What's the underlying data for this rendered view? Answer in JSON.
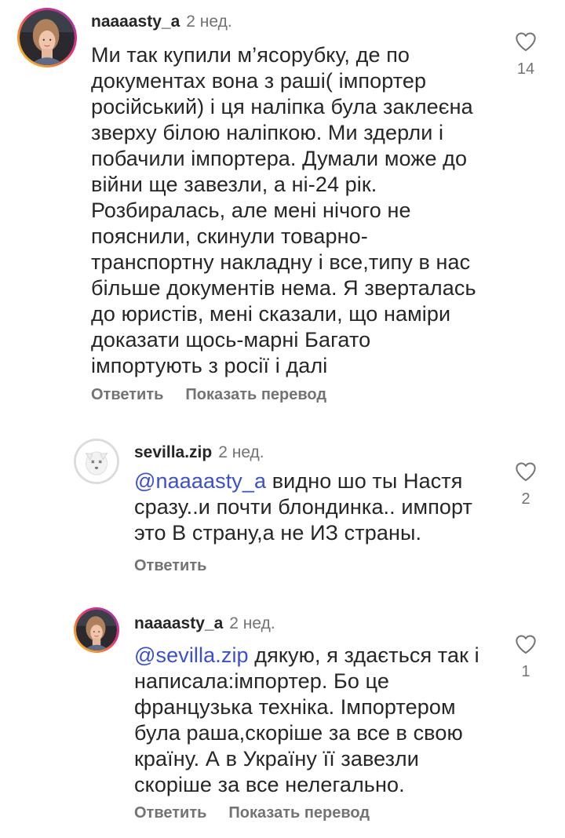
{
  "comments": [
    {
      "username": "naaaasty_a",
      "time": "2 нед.",
      "mention": "",
      "text": "Ми так купили м’ясорубку, де по документах вона з раші( імпортер російський) і ця наліпка була заклеєна зверху білою наліпкою. Ми здерли і побачили імпортера. Думали може до війни ще завезли, а ні-24 рік. Розбиралась, але мені нічого не пояснили, скинули товарно-транспортну накладну і все,типу в нас більше документів нема. Я зверталась до юристів, мені сказали, що наміри доказати щось-марні Багато імпортують з росії і далі",
      "reply": "Ответить",
      "translate": "Показать перевод",
      "likes": "14"
    },
    {
      "username": "sevilla.zip",
      "time": "2 нед.",
      "mention": "@naaaasty_a",
      "text": " видно шо ты Настя сразу..и почти блондинка.. импорт это В страну,а не ИЗ страны.",
      "reply": "Ответить",
      "translate": "",
      "likes": "2"
    },
    {
      "username": "naaaasty_a",
      "time": "2 нед.",
      "mention": "@sevilla.zip",
      "text": " дякую, я здається так і написала:імпортер. Бо це французька техніка. Імпортером була раша,скоріше за все в свою країну. А в Україну її завезли скоріше за все нелегально.",
      "reply": "Ответить",
      "translate": "Показать перевод",
      "likes": "1"
    }
  ],
  "icons": {
    "like": "heart-outline-icon",
    "avatar_1": "user-photo",
    "avatar_2": "dog-avatar",
    "avatar_3": "user-photo"
  },
  "colors": {
    "mention": "#3b4fd0",
    "secondary_text": "#737373",
    "primary_text": "#262626"
  }
}
